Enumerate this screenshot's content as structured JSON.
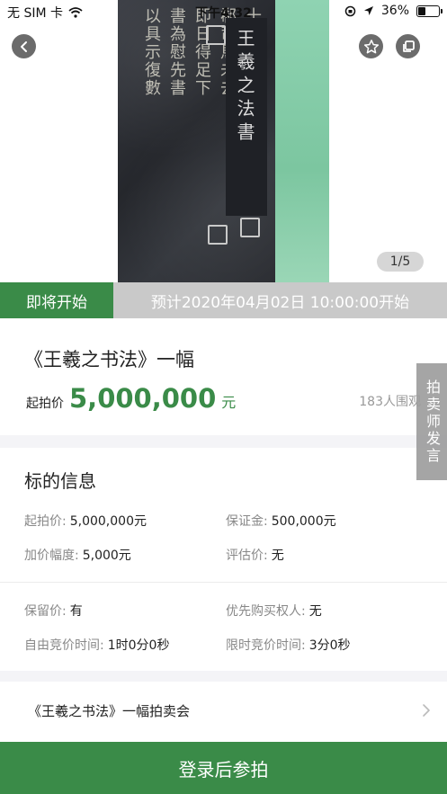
{
  "status_bar": {
    "carrier": "无 SIM 卡",
    "time": "下午4:32",
    "battery": "36%",
    "battery_level": 0.36
  },
  "hero": {
    "page_indicator": "1/5",
    "cover_title": "王羲之法書",
    "inscription_columns": [
      "十七日先書",
      "郗司馬未去",
      "即日得足下",
      "書為慰先書",
      "以具示復數"
    ]
  },
  "status_strip": {
    "badge": "即将开始",
    "scheduled": "预计2020年04月02日 10:00:00开始"
  },
  "lot": {
    "title": "《王羲之书法》一幅",
    "price_label": "起拍价",
    "price_value": "5,000,000",
    "price_unit": "元",
    "watchers": "183人围观"
  },
  "auctioneer_tab": "拍卖师发言",
  "info": {
    "heading": "标的信息",
    "rows": [
      [
        {
          "label": "起拍价:",
          "value": "5,000,000元"
        },
        {
          "label": "保证金:",
          "value": "500,000元"
        }
      ],
      [
        {
          "label": "加价幅度:",
          "value": "5,000元"
        },
        {
          "label": "评估价:",
          "value": "无"
        }
      ],
      [
        {
          "label": "保留价:",
          "value": "有"
        },
        {
          "label": "优先购买权人:",
          "value": "无"
        }
      ],
      [
        {
          "label": "自由竞价时间:",
          "value": "1时0分0秒"
        },
        {
          "label": "限时竞价时间:",
          "value": "3分0秒"
        }
      ]
    ]
  },
  "session": {
    "title": "《王羲之书法》一幅拍卖会"
  },
  "join_button": "登录后参拍",
  "colors": {
    "brand_green": "#3a8b48",
    "strip_gray": "#c9c9c9"
  }
}
